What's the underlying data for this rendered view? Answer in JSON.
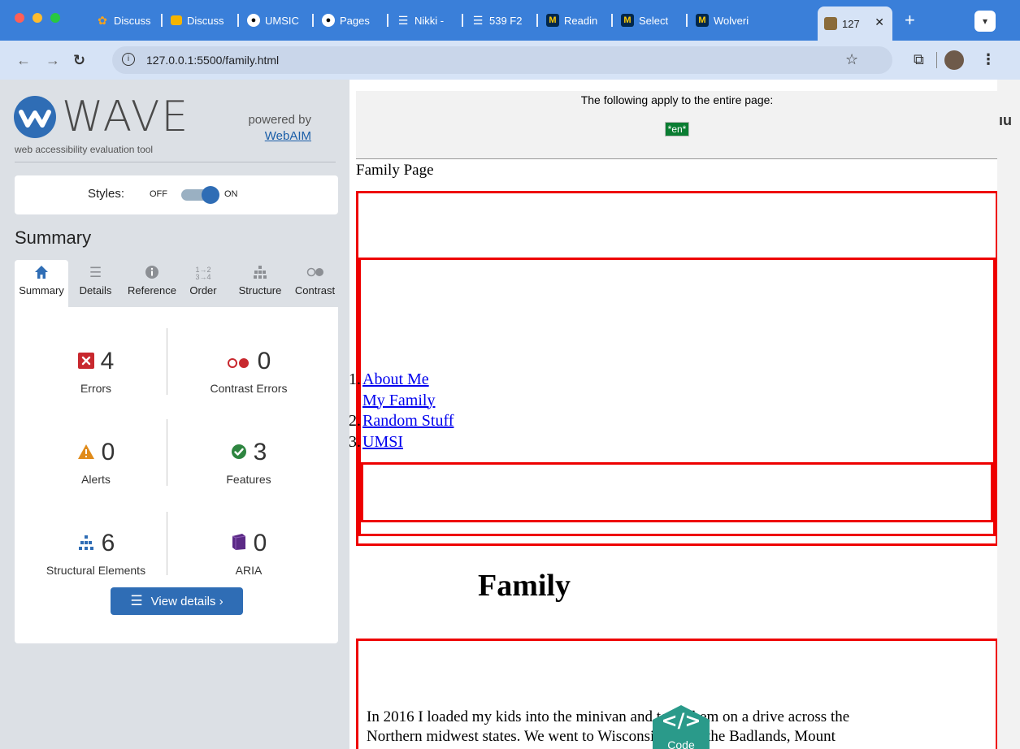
{
  "browser": {
    "tabs": [
      {
        "label": "Discuss",
        "favicon": "discourse-icon"
      },
      {
        "label": "Discuss",
        "favicon": "slides-icon"
      },
      {
        "label": "UMSIC",
        "favicon": "github-icon"
      },
      {
        "label": "Pages",
        "favicon": "github-icon"
      },
      {
        "label": "Nikki -",
        "favicon": "docs-icon"
      },
      {
        "label": "539 F2",
        "favicon": "docs-icon"
      },
      {
        "label": "Readin",
        "favicon": "michigan-icon"
      },
      {
        "label": "Select",
        "favicon": "michigan-icon"
      },
      {
        "label": "Wolveri",
        "favicon": "michigan-icon"
      },
      {
        "label": "127",
        "favicon": "site-icon",
        "active": true
      }
    ],
    "url": "127.0.0.1:5500/family.html"
  },
  "wave": {
    "title": "WAVE",
    "subtitle": "web accessibility evaluation tool",
    "powered_by": "powered by",
    "webaim": "WebAIM",
    "styles_label": "Styles:",
    "styles_off": "OFF",
    "styles_on": "ON",
    "summary_heading": "Summary",
    "tabs": [
      "Summary",
      "Details",
      "Reference",
      "Order",
      "Structure",
      "Contrast"
    ],
    "metrics": {
      "errors": {
        "count": "4",
        "label": "Errors"
      },
      "contrast": {
        "count": "0",
        "label": "Contrast Errors"
      },
      "alerts": {
        "count": "0",
        "label": "Alerts"
      },
      "features": {
        "count": "3",
        "label": "Features"
      },
      "structural": {
        "count": "6",
        "label": "Structural Elements"
      },
      "aria": {
        "count": "0",
        "label": "ARIA"
      }
    },
    "view_details": "View details ›"
  },
  "page": {
    "entire_page_note": "The following apply to the entire page:",
    "lang_badge": "*en*",
    "page_heading": "Family Page",
    "nav": [
      {
        "num": "1.",
        "label": "About Me"
      },
      {
        "num": "",
        "label": "My Family"
      },
      {
        "num": "2.",
        "label": "Random Stuff"
      },
      {
        "num": "3.",
        "label": "UMSI"
      }
    ],
    "family_heading": "Family",
    "paragraph_line1": "In 2016 I loaded my kids into the minivan and took them on a drive across the",
    "paragraph_line2": "Northern midwest states. We went to Wisconsin Dells, the Badlands, Mount",
    "code_badge": "Code",
    "right_edge_text": "ıu"
  },
  "colors": {
    "wave_blue": "#2f6db5",
    "error_red": "#c8282e",
    "alert_orange": "#e08b1a",
    "feature_green": "#2e8540",
    "aria_purple": "#5b2a86",
    "lang_green": "#0a7d32",
    "outline_red": "#ee0000"
  }
}
